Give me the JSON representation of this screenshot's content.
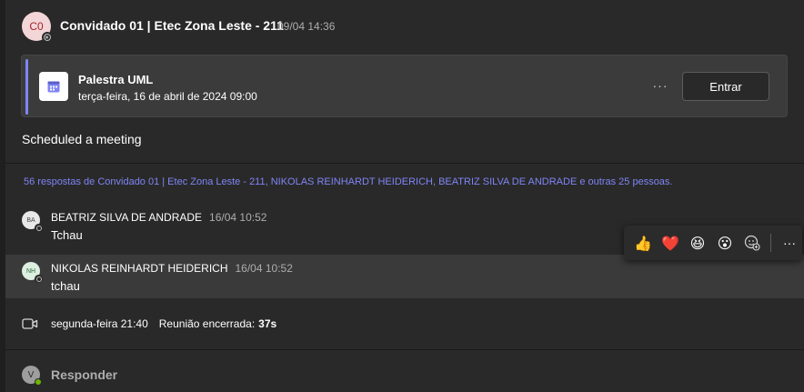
{
  "post": {
    "avatar_initials": "C0",
    "author": "Convidado 01 | Etec Zona Leste - 211",
    "timestamp": "09/04 14:36",
    "meeting": {
      "icon": "calendar-icon",
      "title": "Palestra UML",
      "datetime": "terça-feira, 16 de abril de 2024 09:00",
      "more_label": "···",
      "join_label": "Entrar"
    },
    "message": "Scheduled a meeting"
  },
  "thread": {
    "replies_summary": "56 respostas de Convidado 01 | Etec Zona Leste - 211, NIKOLAS REINHARDT HEIDERICH, BEATRIZ SILVA DE ANDRADE e outras 25 pessoas.",
    "replies": [
      {
        "initials": "BA",
        "author": "BEATRIZ SILVA DE ANDRADE",
        "time": "16/04 10:52",
        "text": "Tchau",
        "avatar_bg": "#e8e8e8",
        "avatar_fg": "#444444"
      },
      {
        "initials": "NH",
        "author": "NIKOLAS REINHARDT HEIDERICH",
        "time": "16/04 10:52",
        "text": "tchau",
        "avatar_bg": "#dcefe1",
        "avatar_fg": "#2e6b3f"
      }
    ],
    "reactions": [
      {
        "name": "thumbs-up-icon",
        "glyph": "👍"
      },
      {
        "name": "heart-icon",
        "glyph": "❤️"
      },
      {
        "name": "laugh-icon",
        "glyph": "😆"
      },
      {
        "name": "surprised-icon",
        "glyph": "😮"
      },
      {
        "name": "add-reaction-icon",
        "glyph": ""
      }
    ],
    "reaction_more": "···",
    "meeting_ended": {
      "day": "segunda-feira 21:40",
      "label": "Reunião encerrada:",
      "duration": "37s"
    },
    "respond": {
      "avatar_initial": "V",
      "label": "Responder"
    }
  },
  "colors": {
    "accent": "#7f85f5",
    "background": "#292929",
    "card": "#3b3b3b",
    "presence_available": "#6bb700"
  }
}
